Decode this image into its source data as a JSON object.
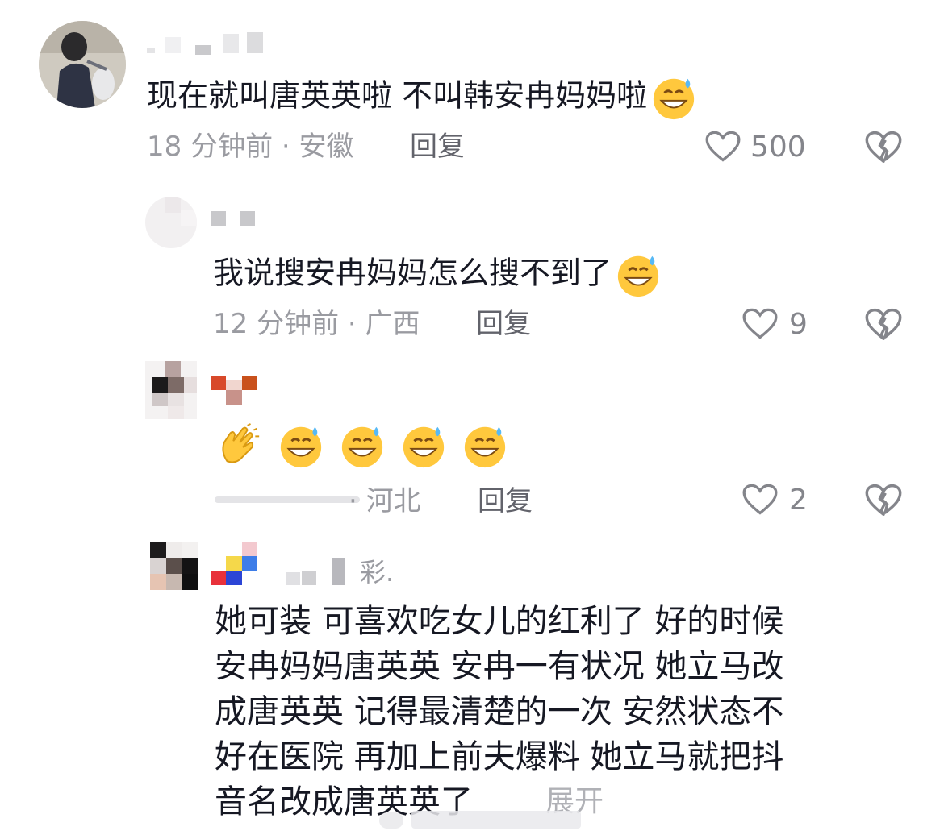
{
  "comments": [
    {
      "text": "现在就叫唐英英啦 不叫韩安冉妈妈啦",
      "emoji": "grinning-sweat-emoji",
      "time_location": "18 分钟前 · 安徽",
      "reply_label": "回复",
      "likes": "500"
    },
    {
      "text": "我说搜安冉妈妈怎么搜不到了",
      "emoji": "grinning-sweat-emoji",
      "time_location": "12 分钟前 · 广西",
      "reply_label": "回复",
      "likes": "9"
    },
    {
      "emojis": [
        "clapping-hand-emoji",
        "grinning-sweat-emoji",
        "grinning-sweat-emoji",
        "grinning-sweat-emoji",
        "grinning-sweat-emoji"
      ],
      "time_location_partial": "· 河北",
      "reply_label": "回复",
      "likes": "2"
    },
    {
      "username_partial": "彩.",
      "lines": [
        "她可装  可喜欢吃女儿的红利了    好的时候",
        "安冉妈妈唐英英   安冉一有状况 她立马改",
        "成唐英英  记得最清楚的一次  安然状态不",
        "好在医院  再加上前夫爆料  她立马就把抖",
        "音名改成唐英英了"
      ],
      "expand_label": "展开"
    }
  ],
  "colors": {
    "text": "#161823",
    "meta": "#9a9ba1",
    "reply": "#62636b",
    "icon": "#84858b"
  }
}
